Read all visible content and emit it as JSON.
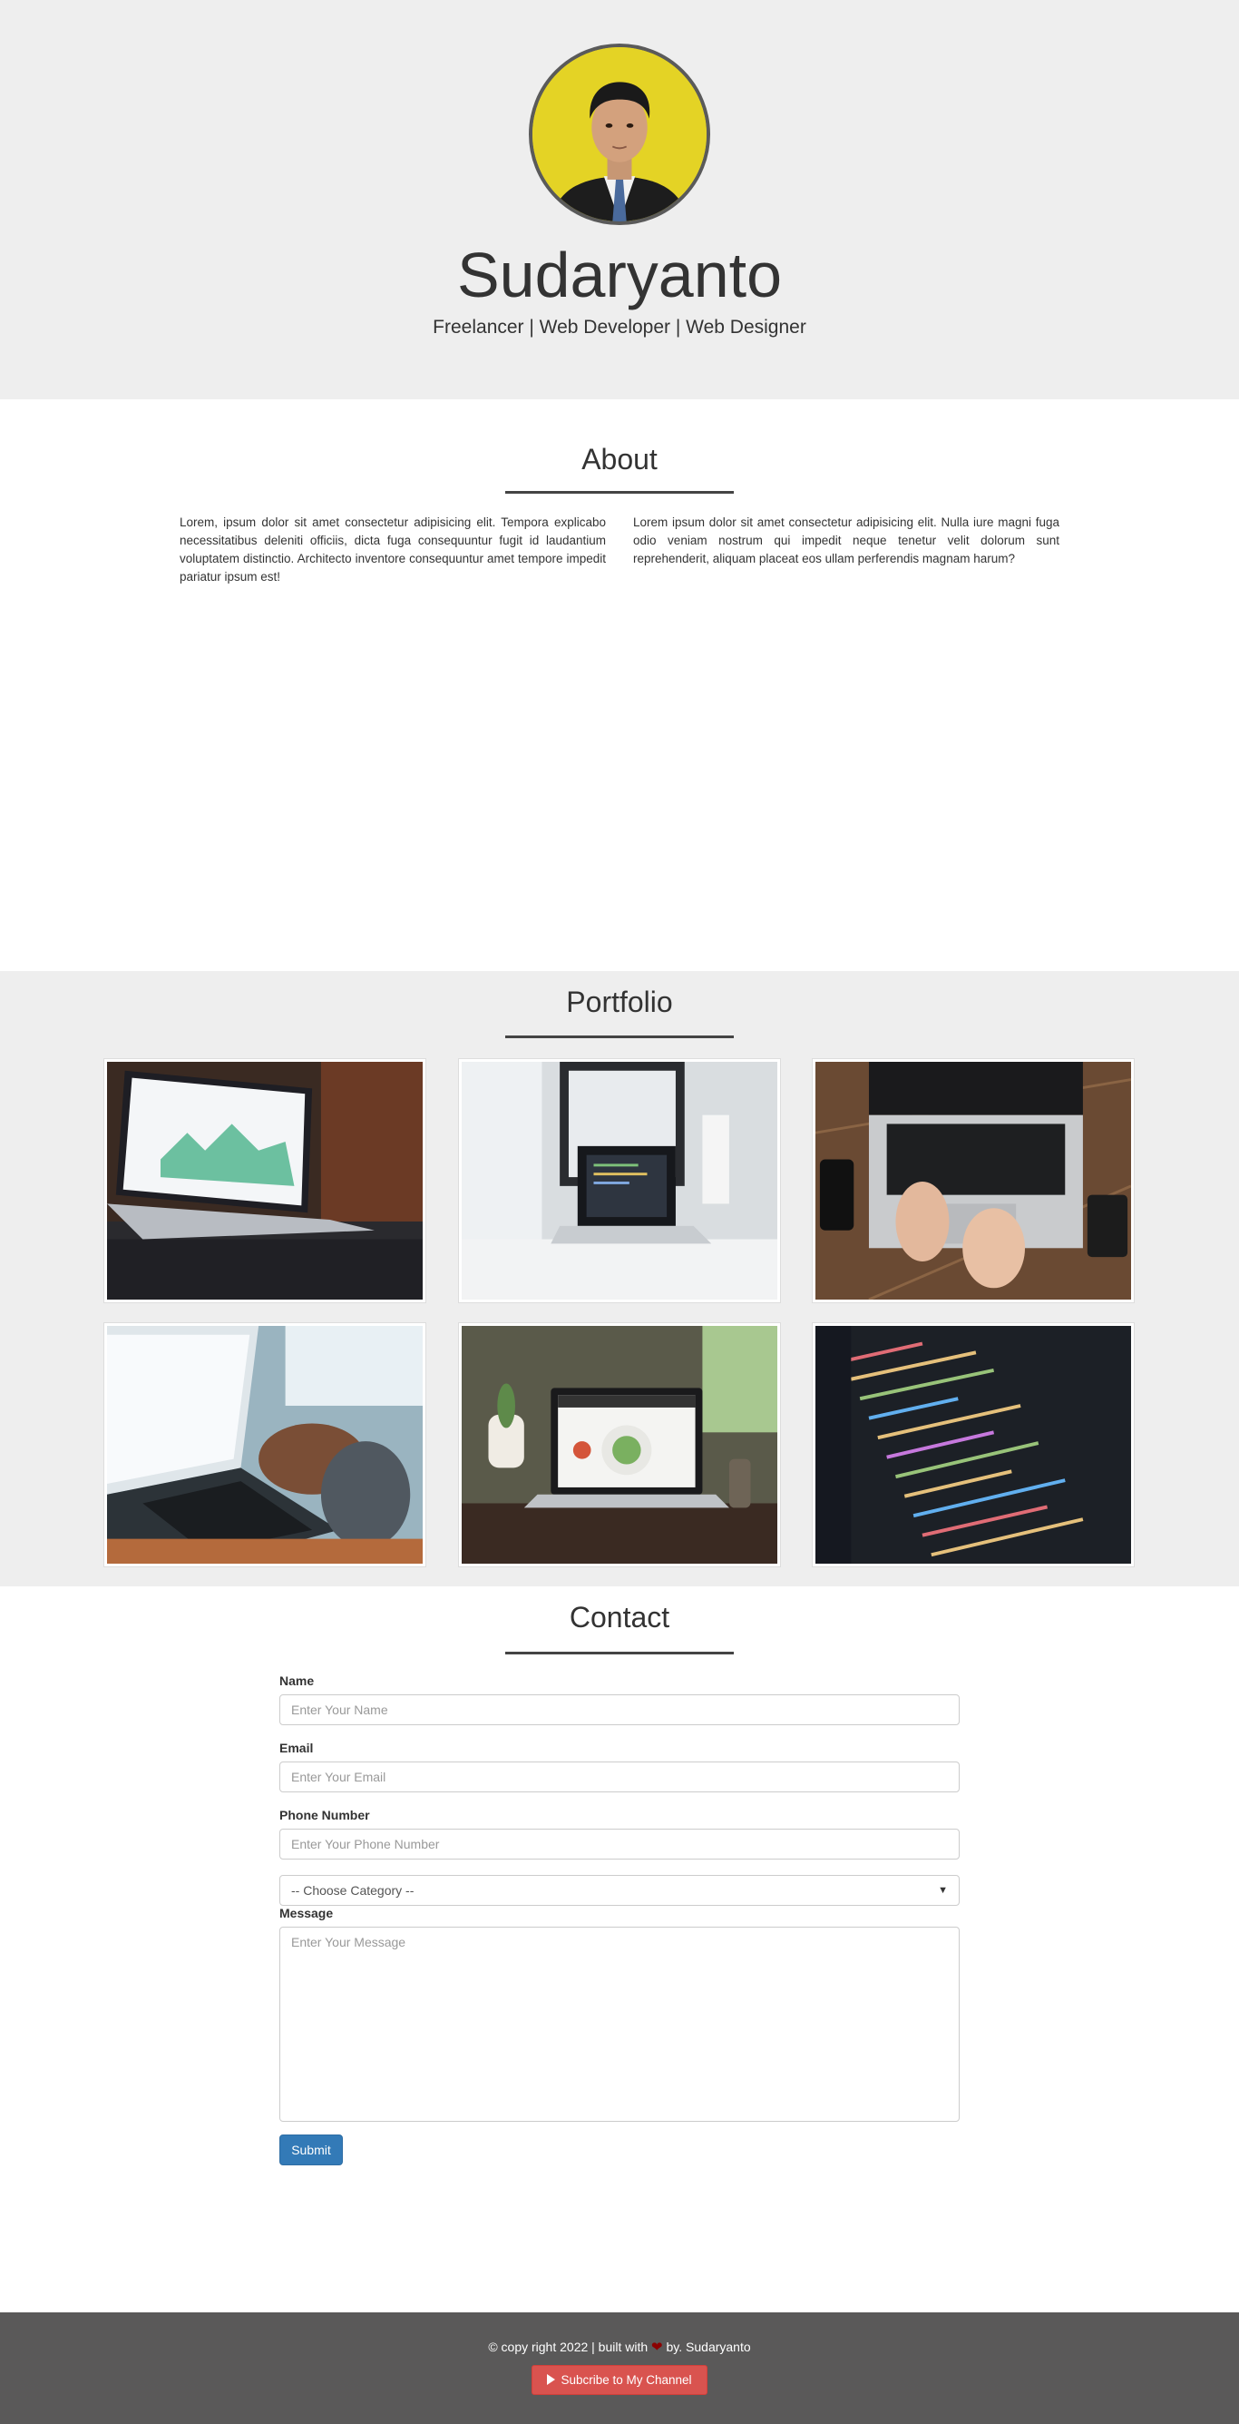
{
  "hero": {
    "name": "Sudaryanto",
    "tagline": "Freelancer | Web Developer | Web Designer"
  },
  "about": {
    "title": "About",
    "left_text": "Lorem, ipsum dolor sit amet consectetur adipisicing elit. Tempora explicabo necessitatibus deleniti officiis, dicta fuga consequuntur fugit id laudantium voluptatem distinctio. Architecto inventore consequuntur amet tempore impedit pariatur ipsum est!",
    "right_text": "Lorem ipsum dolor sit amet consectetur adipisicing elit. Nulla iure magni fuga odio veniam nostrum qui impedit neque tenetur velit dolorum sunt reprehenderit, aliquam placeat eos ullam perferendis magnam harum?"
  },
  "portfolio": {
    "title": "Portfolio"
  },
  "contact": {
    "title": "Contact",
    "name_label": "Name",
    "name_placeholder": "Enter Your Name",
    "email_label": "Email",
    "email_placeholder": "Enter Your Email",
    "phone_label": "Phone Number",
    "phone_placeholder": "Enter Your Phone Number",
    "category_selected": "-- Choose Category --",
    "message_label": "Message",
    "message_placeholder": "Enter Your Message",
    "submit_label": "Submit"
  },
  "footer": {
    "copyright_prefix": "© copy right 2022 | built with",
    "copyright_suffix": "by. Sudaryanto",
    "subscribe_label": "Subcribe to My Channel"
  },
  "colors": {
    "section_bg": "#eeeeee",
    "footer_bg": "#5a5959",
    "primary": "#337ab7",
    "danger": "#d9534f"
  }
}
